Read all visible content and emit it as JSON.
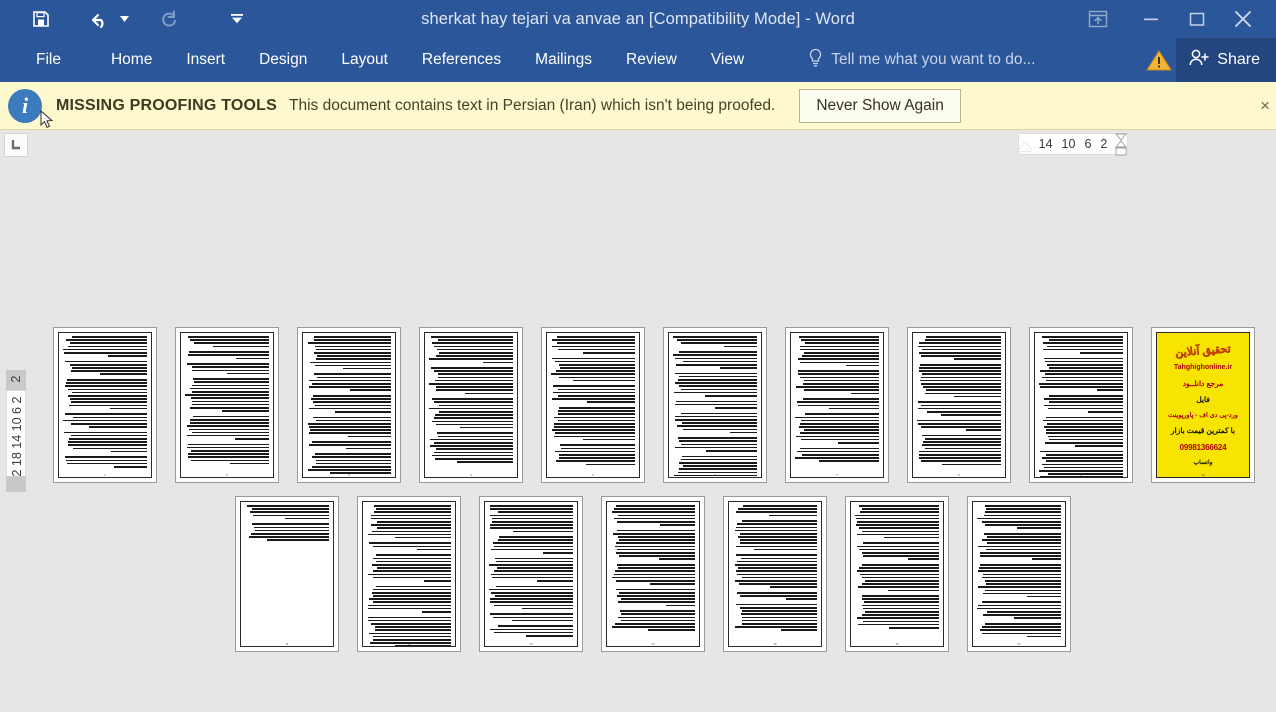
{
  "titlebar": {
    "document_title": "sherkat hay tejari va anvae an [Compatibility Mode] - Word",
    "quick_access": [
      {
        "name": "save-icon",
        "label": "Save"
      },
      {
        "name": "undo-icon",
        "label": "Undo"
      },
      {
        "name": "redo-icon",
        "label": "Redo"
      },
      {
        "name": "customize-quick-access-icon",
        "label": "Customize Quick Access Toolbar"
      }
    ],
    "window_controls": [
      {
        "name": "ribbon-display-options-icon",
        "label": "Ribbon Display Options"
      },
      {
        "name": "minimize-icon",
        "label": "Minimize"
      },
      {
        "name": "restore-icon",
        "label": "Restore Down"
      },
      {
        "name": "close-icon",
        "label": "Close"
      }
    ]
  },
  "ribbon": {
    "tabs": [
      {
        "label": "File"
      },
      {
        "label": "Home"
      },
      {
        "label": "Insert"
      },
      {
        "label": "Design"
      },
      {
        "label": "Layout"
      },
      {
        "label": "References"
      },
      {
        "label": "Mailings"
      },
      {
        "label": "Review"
      },
      {
        "label": "View"
      }
    ],
    "tell_me_placeholder": "Tell me what you want to do...",
    "share_label": "Share",
    "accent_color": "#2b579a"
  },
  "notification": {
    "strong_label": "MISSING PROOFING TOOLS",
    "message": "This document contains text in Persian (Iran) which isn't being proofed.",
    "button_label": "Never Show Again",
    "close_label": "×",
    "info_glyph": "i",
    "background_color": "#fdf8cd"
  },
  "rulers": {
    "tab_stop_selector": "L",
    "horizontal_ticks": [
      "14",
      "10",
      "6",
      "2"
    ],
    "vertical_ticks": "22 18 14 10 6 2",
    "vertical_top_tick": "2"
  },
  "document": {
    "zoom_view": "multiple-pages",
    "rows": [
      {
        "pages": [
          {
            "page_number": "1",
            "kind": "text"
          },
          {
            "page_number": "2",
            "kind": "text"
          },
          {
            "page_number": "3",
            "kind": "text"
          },
          {
            "page_number": "4",
            "kind": "text"
          },
          {
            "page_number": "5",
            "kind": "text"
          },
          {
            "page_number": "6",
            "kind": "text"
          },
          {
            "page_number": "7",
            "kind": "text"
          },
          {
            "page_number": "8",
            "kind": "text"
          },
          {
            "page_number": "9",
            "kind": "text"
          },
          {
            "page_number": "10",
            "kind": "ad"
          }
        ]
      },
      {
        "pages": [
          {
            "page_number": "11",
            "kind": "text-partial"
          },
          {
            "page_number": "12",
            "kind": "text"
          },
          {
            "page_number": "13",
            "kind": "text"
          },
          {
            "page_number": "14",
            "kind": "text"
          },
          {
            "page_number": "15",
            "kind": "text"
          },
          {
            "page_number": "16",
            "kind": "text"
          },
          {
            "page_number": "17",
            "kind": "text"
          }
        ]
      }
    ],
    "ad_page": {
      "title": "تحقیق آنلاین",
      "url": "Tahghighonline.ir",
      "line1": "مرجع دانلــود",
      "line2": "فایل",
      "line3": "ورد-پی دی اف - پاورپوینت",
      "line4": "با کمترین قیمت بازار",
      "phone": "09981366624",
      "whatsapp": "واتساپ",
      "background_color": "#f7e400"
    }
  }
}
